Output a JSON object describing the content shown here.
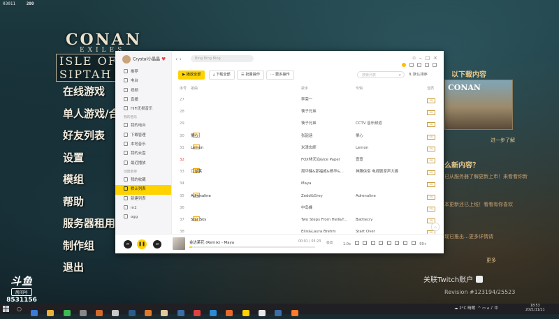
{
  "overlay": {
    "fps_left": "03011",
    "fps_right": "200"
  },
  "game": {
    "logo_line1": "CONAN",
    "logo_line2": "EXILES",
    "logo_line3": "ISLE OF SIPTAH",
    "menu": [
      "在线游戏",
      "单人游戏/合",
      "好友列表",
      "设置",
      "模组",
      "帮助",
      "服务器租用",
      "制作组",
      "退出"
    ],
    "news_title": "以下载内容",
    "news_card_title": "CONAN",
    "news_more": "进一步了解",
    "news_title2": "么新内容？",
    "news_p1": "已从服务器了解更新上市！来看看你新",
    "news_p2": "本更新还已上线！看看有你喜欢",
    "news_p3": "现已推出…更多详情请",
    "news_more2": "更多",
    "twitch_label": "关联Twitch账户",
    "bottom_text": "Revision #123194/25523"
  },
  "watermark": {
    "brand": "斗鱼",
    "sub": "房间号",
    "room": "8531156"
  },
  "music": {
    "user": "Crystal小晶晶",
    "search_placeholder": "Bing Bing Bing",
    "toolbar": {
      "play_all": "播放全部",
      "download_all": "下载全部",
      "batch": "批量操作",
      "more": "更多操作",
      "list_search_placeholder": "搜索列表",
      "sort": "默认排序"
    },
    "sidebar": {
      "top_items": [
        "推荐",
        "电台",
        "视频",
        "直播",
        "HiFi无损音乐"
      ],
      "section_mine": "我的音乐",
      "mine_items": [
        "我的电台",
        "下载管理",
        "本地音乐",
        "我的云盘",
        "最近播放"
      ],
      "section_created": "创建歌单",
      "created_items": [
        "我的收藏",
        "默认列表",
        "新建列表",
        "m2",
        "ogg"
      ],
      "active_item": "默认列表"
    },
    "columns": {
      "index": "序号",
      "title": "歌曲",
      "artist": "歌手",
      "album": "专辑",
      "quality": "音质"
    },
    "rows": [
      {
        "n": "27",
        "title": "蒲公今有",
        "tag": "",
        "artist": "李荣一",
        "album": "",
        "q": "SQ"
      },
      {
        "n": "28",
        "title": "父亲（天天向上）",
        "tag": "",
        "artist": "筷子兄弟",
        "album": "",
        "q": "SQ"
      },
      {
        "n": "29",
        "title": "老男孩(CCTV 音乐频道)",
        "tag": "",
        "artist": "筷子兄弟",
        "album": "CCTV 音乐频道",
        "q": "SQ"
      },
      {
        "n": "30",
        "title": "栗心",
        "tag": "MV",
        "artist": "张韶涵",
        "album": "栗心",
        "q": "SQ"
      },
      {
        "n": "31",
        "title": "Lemon",
        "tag": "MV",
        "artist": "米津玄師",
        "album": "Lemon",
        "q": "SQ"
      },
      {
        "n": "32",
        "title": "修耸",
        "tag": "",
        "artist": "FOX林沃汕&Ice Paper",
        "album": "壹壹",
        "q": "SQ",
        "red": true
      },
      {
        "n": "33",
        "title": "江湖笑",
        "tag": "MV",
        "artist": "周华健&郭福威&杨华&...",
        "album": "神雕侠侣 电视剧原声大碟",
        "q": "SQ"
      },
      {
        "n": "34",
        "title": "金达莱花 (Remix)",
        "tag": "",
        "artist": "Maya",
        "album": "",
        "q": "SQ"
      },
      {
        "n": "35",
        "title": "Adrenaline",
        "tag": "VIP",
        "artist": "Zedd&Grey",
        "album": "Adrenaline",
        "q": "SQ"
      },
      {
        "n": "36",
        "title": "Vision",
        "tag": "",
        "artist": "中岛峰",
        "album": "",
        "q": "SQ"
      },
      {
        "n": "37",
        "title": "Star Sky",
        "tag": "MV",
        "artist": "Two Steps From Hell&T...",
        "album": "Battlecry",
        "q": "SQ"
      },
      {
        "n": "38",
        "title": "Start Over",
        "tag": "",
        "artist": "Ellis&Laura Brehm",
        "album": "Start Over",
        "q": "SQ"
      }
    ],
    "player": {
      "now_playing": "金达莱花 (Remix) - Maya",
      "time": "00:01 / 03:23",
      "quality_label": "极高",
      "progress": 0.02,
      "speed": "1.0x",
      "count": "99+"
    }
  },
  "taskbar": {
    "temp": "2°C 晴朗",
    "time": "18:53",
    "date": "2021/11/21"
  }
}
